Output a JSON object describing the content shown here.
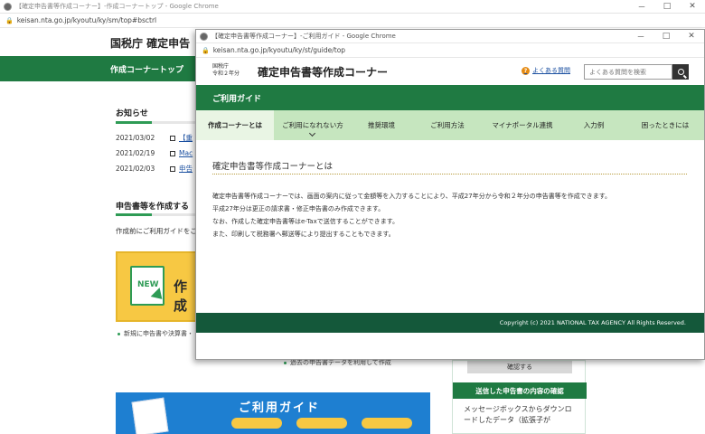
{
  "background_window": {
    "title": "【確定申告書等作成コーナー】-作成コーナートップ - Google Chrome",
    "url": "keisan.nta.go.jp/kyoutu/ky/sm/top#bsctrl",
    "site_title": "国税庁 確定申告",
    "nav_item": "作成コーナートップ",
    "news_heading": "お知らせ",
    "news": [
      {
        "date": "2021/03/02",
        "text": "【重"
      },
      {
        "date": "2021/02/19",
        "text": "Mac"
      },
      {
        "date": "2021/02/03",
        "text": "申告"
      }
    ],
    "create_heading": "申告書等を作成する",
    "create_desc": "作成前にご利用ガイドをご",
    "create_card_new": "NEW",
    "create_card_text": "作成",
    "bullet_new": "新規に申告書や決算書・",
    "bullet_past": "過去の申告書データを利用して作成",
    "guide_banner_title": "ご利用ガイド",
    "side_button": "確認する",
    "side_heading": "送信した申告書の内容の確認",
    "side_text": "メッセージボックスからダウンロードしたデータ（拡張子が"
  },
  "popup_window": {
    "title": "【確定申告書等作成コーナー】-ご利用ガイド - Google Chrome",
    "url": "keisan.nta.go.jp/kyoutu/ky/st/guide/top",
    "agency": "国税庁",
    "era": "令和２年分",
    "site_title": "確定申告書等作成コーナー",
    "faq_link": "よくある質問",
    "search_placeholder": "よくある質問を検索",
    "guide_bar": "ご利用ガイド",
    "tabs": [
      "作成コーナーとは",
      "ご利用になれない方",
      "推奨環境",
      "ご利用方法",
      "マイナポータル連携",
      "入力例",
      "困ったときには"
    ],
    "active_tab": "作成コーナーとは",
    "heading": "確定申告書等作成コーナーとは",
    "paragraphs": [
      "確定申告書等作成コーナーでは、画面の案内に従って金額等を入力することにより、平成27年分から令和２年分の申告書等を作成できます。",
      "平成27年分は更正の請求書・修正申告書のみ作成できます。",
      "なお、作成した確定申告書等はe-Taxで送信することができます。",
      "また、印刷して税務署へ郵送等により提出することもできます。"
    ],
    "footer": "Copyright (c) 2021 NATIONAL TAX AGENCY All Rights Reserved."
  },
  "window_controls": {
    "minimize": "－",
    "maximize": "□",
    "close": "✕"
  }
}
